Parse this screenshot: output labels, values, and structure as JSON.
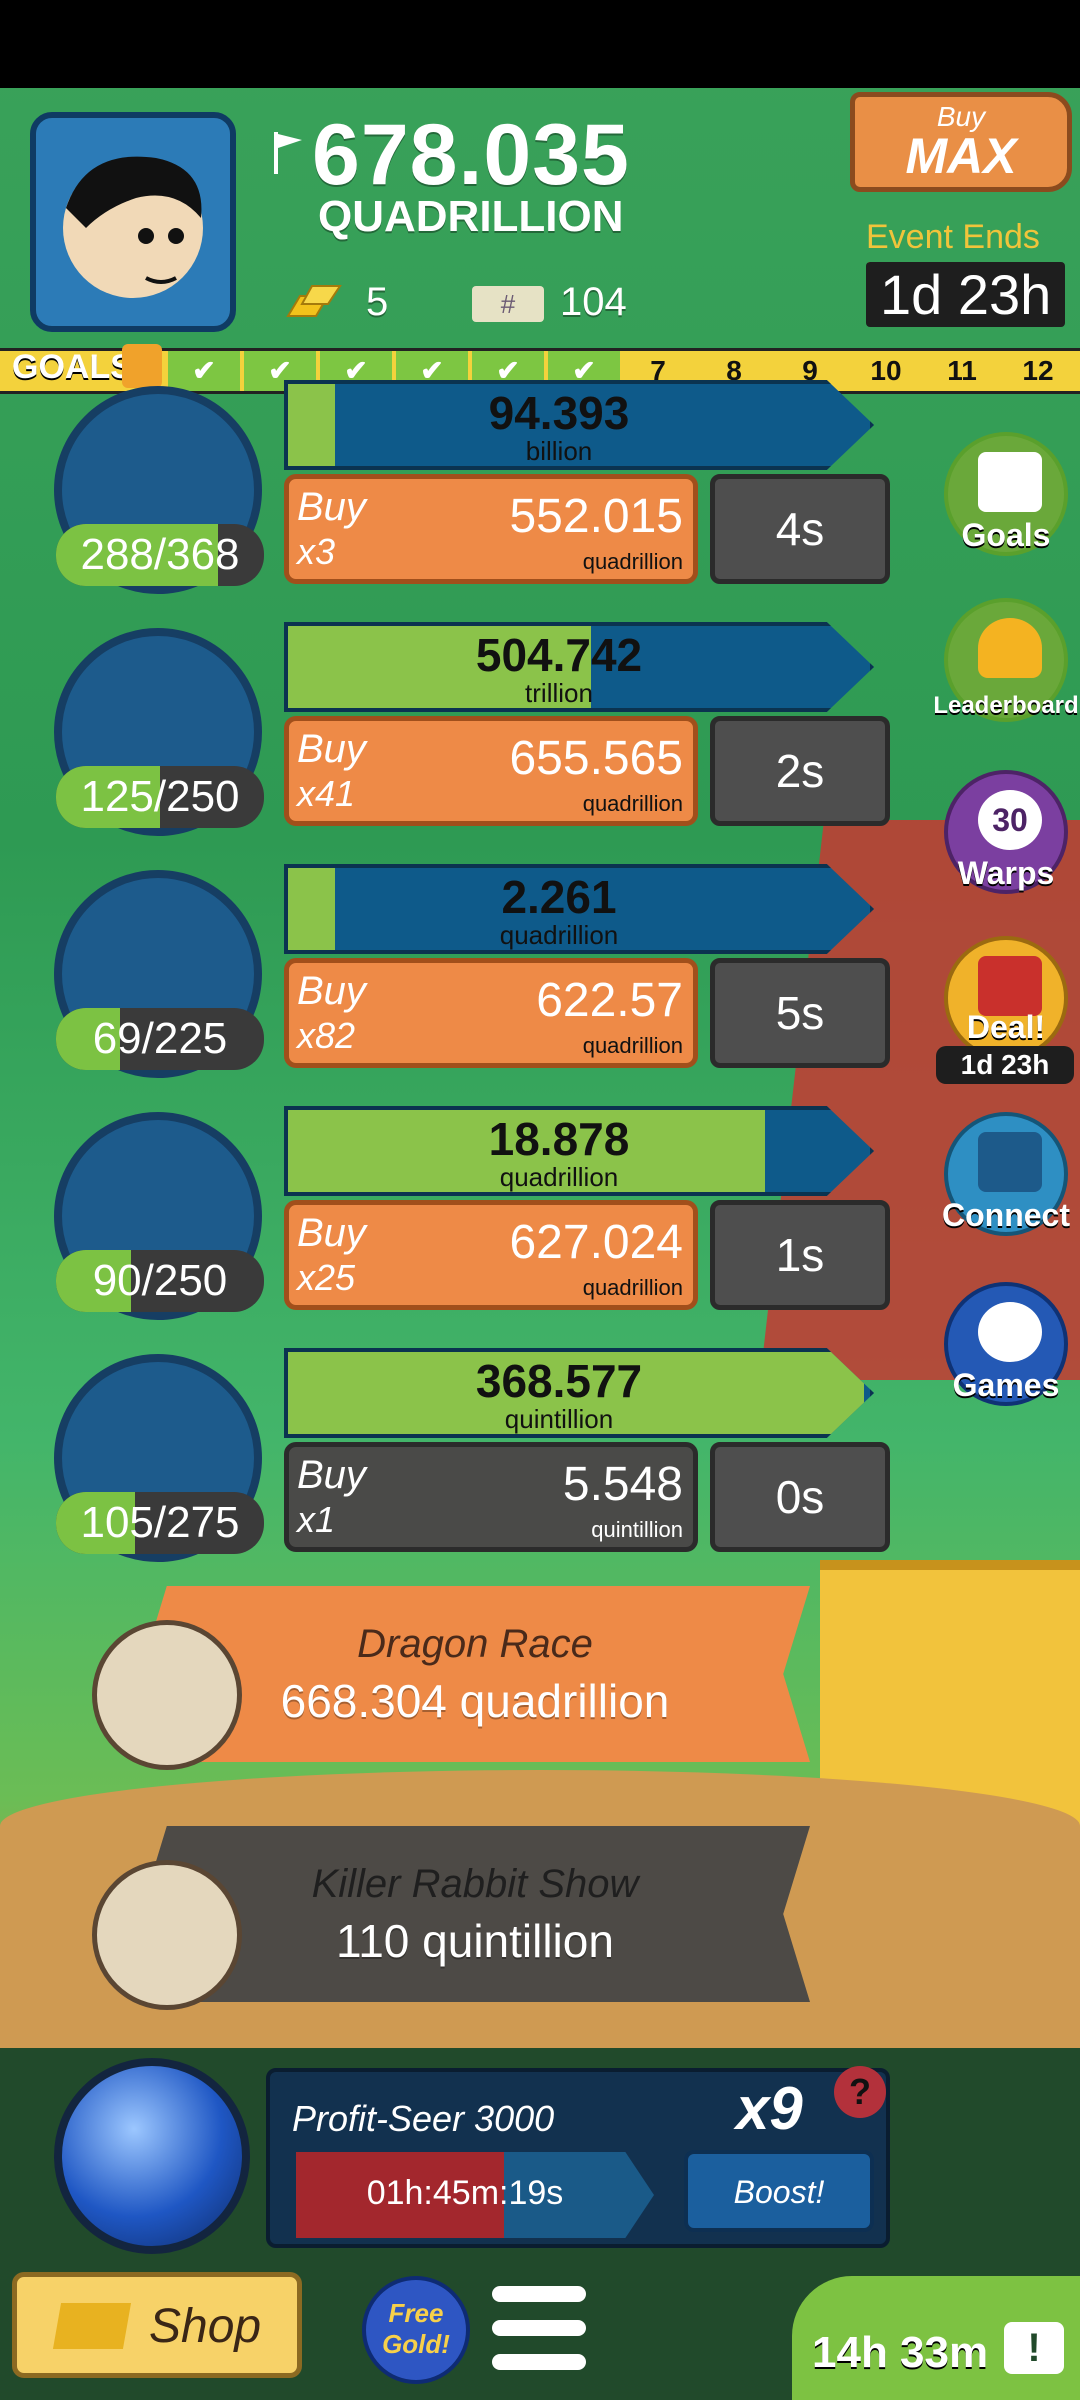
{
  "header": {
    "money_value": "678.035",
    "money_unit": "QUADRILLION",
    "gold_count": "5",
    "ticket_count": "104",
    "ticket_symbol": "#",
    "buy_max_top": "Buy",
    "buy_max_bottom": "MAX",
    "event_label": "Event Ends in:",
    "event_time": "1d 23h"
  },
  "goals": {
    "label": "GOALS",
    "completed_count": 6,
    "numbers": [
      "7",
      "8",
      "9",
      "10",
      "11",
      "12"
    ]
  },
  "businesses": [
    {
      "owned": "288/368",
      "owned_fraction": 0.78,
      "profit": "94.393",
      "profit_unit": "billion",
      "progress": 0.08,
      "buy": "Buy",
      "mult": "x3",
      "price": "552.015",
      "price_unit": "quadrillion",
      "timer": "4s"
    },
    {
      "owned": "125/250",
      "owned_fraction": 0.5,
      "profit": "504.742",
      "profit_unit": "trillion",
      "progress": 0.52,
      "buy": "Buy",
      "mult": "x41",
      "price": "655.565",
      "price_unit": "quadrillion",
      "timer": "2s"
    },
    {
      "owned": "69/225",
      "owned_fraction": 0.31,
      "profit": "2.261",
      "profit_unit": "quadrillion",
      "progress": 0.08,
      "buy": "Buy",
      "mult": "x82",
      "price": "622.57",
      "price_unit": "quadrillion",
      "timer": "5s"
    },
    {
      "owned": "90/250",
      "owned_fraction": 0.36,
      "profit": "18.878",
      "profit_unit": "quadrillion",
      "progress": 0.82,
      "buy": "Buy",
      "mult": "x25",
      "price": "627.024",
      "price_unit": "quadrillion",
      "timer": "1s"
    },
    {
      "owned": "105/275",
      "owned_fraction": 0.38,
      "profit": "368.577",
      "profit_unit": "quintillion",
      "progress": 0.99,
      "buy": "Buy",
      "mult": "x1",
      "price": "5.548",
      "price_unit": "quintillion",
      "timer": "0s"
    }
  ],
  "side": {
    "goals": "Goals",
    "leaderboard": "Leaderboard",
    "warps_count": "30",
    "warps": "Warps",
    "deal": "Deal!",
    "deal_time": "1d 23h",
    "connect": "Connect",
    "games": "Games"
  },
  "features": [
    {
      "name": "Dragon Race",
      "value": "668.304 quadrillion"
    },
    {
      "name": "Killer Rabbit Show",
      "value": "110 quintillion"
    }
  ],
  "seer": {
    "title": "Profit-Seer 3000",
    "multiplier": "x9",
    "help": "?",
    "timer": "01h:45m:19s",
    "boost": "Boost!"
  },
  "bottom": {
    "shop": "Shop",
    "free_gold": "Free Gold!",
    "tv_time": "14h 33m",
    "tv_symbol": "!"
  },
  "colors": {
    "orange": "#ee8a47",
    "blue": "#0e5a8a",
    "green": "#8bc34a",
    "grey": "#4a4a48"
  }
}
